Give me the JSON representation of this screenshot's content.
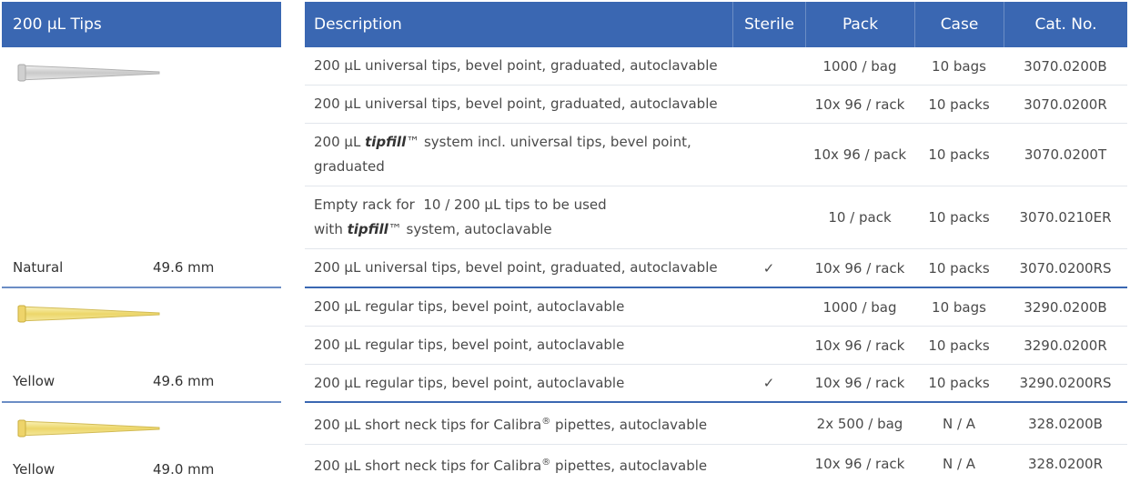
{
  "left_panel": {
    "header": "200 µL Tips",
    "items": [
      {
        "color": "Natural",
        "length": "49.6 mm",
        "tint": "#d8d8d8"
      },
      {
        "color": "Yellow",
        "length": "49.6 mm",
        "tint": "#f2e27a"
      },
      {
        "color": "Yellow",
        "length": "49.0 mm",
        "tint": "#f2e27a"
      }
    ]
  },
  "table": {
    "headers": {
      "description": "Description",
      "sterile": "Sterile",
      "pack": "Pack",
      "case": "Case",
      "cat_no": "Cat. No."
    },
    "rows": [
      {
        "desc": "200 µL universal tips, bevel point, graduated, autoclavable",
        "sterile": "",
        "pack": "1000 / bag",
        "case": "10 bags",
        "cat": "3070.0200B"
      },
      {
        "desc": "200 µL universal tips, bevel point, graduated, autoclavable",
        "sterile": "",
        "pack": "10x 96 / rack",
        "case": "10 packs",
        "cat": "3070.0200R"
      },
      {
        "desc_pre": "200 µL ",
        "desc_brand": "tipfill",
        "desc_post": "™ system incl. universal tips, bevel point, graduated",
        "sterile": "",
        "pack": "10x 96 / pack",
        "case": "10 packs",
        "cat": "3070.0200T"
      },
      {
        "desc_pre": "Empty rack for  10 / 200 µL tips to be used",
        "desc_mid": "with ",
        "desc_brand": "tipfill",
        "desc_post": "™ system, autoclavable",
        "sterile": "",
        "pack": "10 / pack",
        "case": "10 packs",
        "cat": "3070.0210ER"
      },
      {
        "desc": "200 µL universal tips, bevel point, graduated, autoclavable",
        "sterile": "✓",
        "pack": "10x 96 / rack",
        "case": "10 packs",
        "cat": "3070.0200RS"
      },
      {
        "desc": "200 µL regular tips, bevel point, autoclavable",
        "sterile": "",
        "pack": "1000 / bag",
        "case": "10 bags",
        "cat": "3290.0200B"
      },
      {
        "desc": "200 µL regular tips, bevel point, autoclavable",
        "sterile": "",
        "pack": "10x 96 / rack",
        "case": "10 packs",
        "cat": "3290.0200R"
      },
      {
        "desc": "200 µL regular tips, bevel point, autoclavable",
        "sterile": "✓",
        "pack": "10x 96 / rack",
        "case": "10 packs",
        "cat": "3290.0200RS"
      },
      {
        "desc_pre": "200 µL short neck tips for Calibra",
        "desc_sup": "®",
        "desc_post": " pipettes, autoclavable",
        "sterile": "",
        "pack": "2x 500 / bag",
        "case": "N / A",
        "cat": "328.0200B"
      },
      {
        "desc_pre": "200 µL short neck tips for Calibra",
        "desc_sup": "®",
        "desc_post": " pipettes, autoclavable",
        "sterile": "",
        "pack": "10x 96 / rack",
        "case": "N / A",
        "cat": "328.0200R"
      }
    ]
  }
}
